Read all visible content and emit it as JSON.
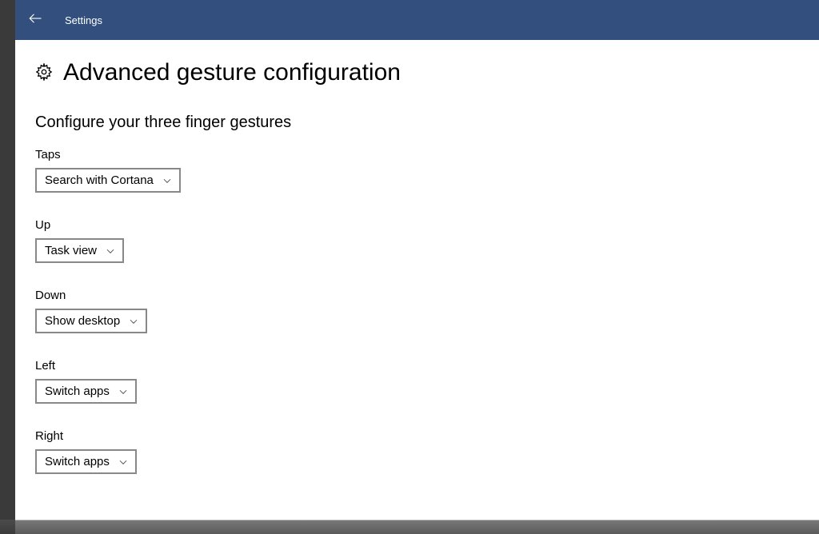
{
  "titlebar": {
    "app_label": "Settings"
  },
  "page": {
    "title": "Advanced gesture configuration",
    "section_heading": "Configure your three finger gestures"
  },
  "fields": {
    "taps": {
      "label": "Taps",
      "value": "Search with Cortana"
    },
    "up": {
      "label": "Up",
      "value": "Task view"
    },
    "down": {
      "label": "Down",
      "value": "Show desktop"
    },
    "left": {
      "label": "Left",
      "value": "Switch apps"
    },
    "right": {
      "label": "Right",
      "value": "Switch apps"
    }
  }
}
